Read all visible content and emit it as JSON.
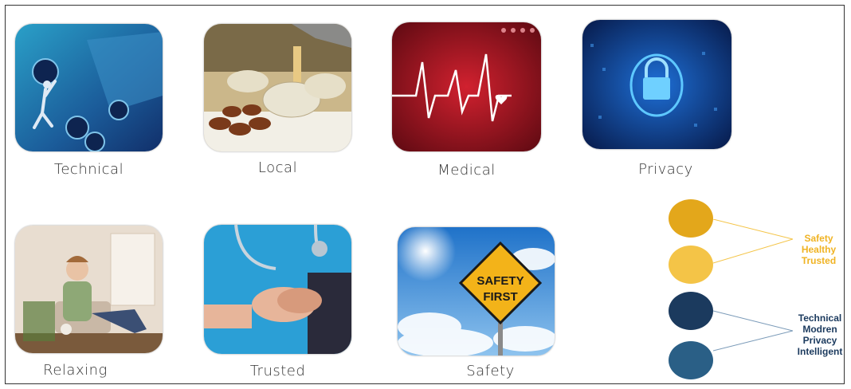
{
  "tiles": [
    {
      "label": "Technical",
      "image": "gears-and-keyboard"
    },
    {
      "label": "Local",
      "image": "arabic-coffee-and-dates"
    },
    {
      "label": "Medical",
      "image": "heartbeat-line"
    },
    {
      "label": "Privacy",
      "image": "digital-padlock"
    },
    {
      "label": "Relaxing",
      "image": "woman-relaxing-on-sofa"
    },
    {
      "label": "Trusted",
      "image": "nurse-holding-hands"
    },
    {
      "label": "Safety",
      "image": "safety-first-sign"
    }
  ],
  "sign_text": {
    "line1": "SAFETY",
    "line2": "FIRST"
  },
  "legend": {
    "group1": {
      "lines": [
        "Safety",
        "Healthy",
        "Trusted"
      ],
      "color": "#f0b323"
    },
    "group2": {
      "lines": [
        "Technical",
        "Modren",
        "Privacy",
        "Intelligent"
      ],
      "color": "#1b3a5e"
    }
  },
  "circle_colors": [
    "#e3a71b",
    "#f4c447",
    "#1b3a5e",
    "#2a5f86"
  ]
}
